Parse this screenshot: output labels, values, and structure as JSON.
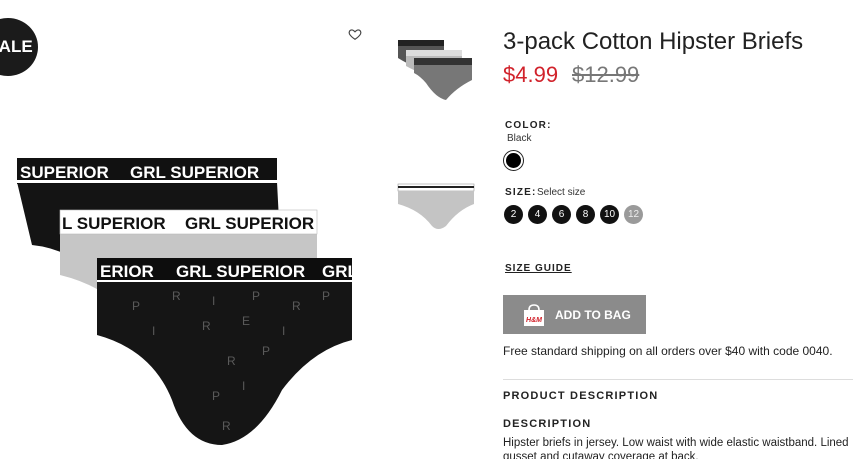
{
  "badge": {
    "label": "SALE"
  },
  "product": {
    "title": "3-pack Cotton Hipster Briefs",
    "price_current": "$4.99",
    "price_original": "$12.99"
  },
  "images": {
    "band_text": "GRL SUPERIOR",
    "band_left": "SUPERIOR",
    "band_left2": "L SUPERIOR",
    "band_left3": "ERIOR",
    "band_right3": "GRL"
  },
  "color": {
    "label": "COLOR:",
    "value": "Black",
    "swatch_hex": "#000000"
  },
  "size": {
    "label": "SIZE:",
    "hint": "Select size",
    "options": [
      "2",
      "4",
      "6",
      "8",
      "10",
      "12"
    ]
  },
  "size_guide": "SIZE GUIDE",
  "add_to_bag": {
    "label": "ADD TO BAG",
    "logo": "H&M"
  },
  "shipping": "Free standard shipping on all orders over $40 with code 0040.",
  "product_description": {
    "heading": "PRODUCT DESCRIPTION"
  },
  "description": {
    "heading": "DESCRIPTION",
    "text": "Hipster briefs in jersey. Low waist with wide elastic waistband. Lined gusset and cutaway coverage at back."
  },
  "colors": {
    "price_sale": "#d1222b",
    "button": "#8b8b8b",
    "badge": "#1b1b1b"
  }
}
